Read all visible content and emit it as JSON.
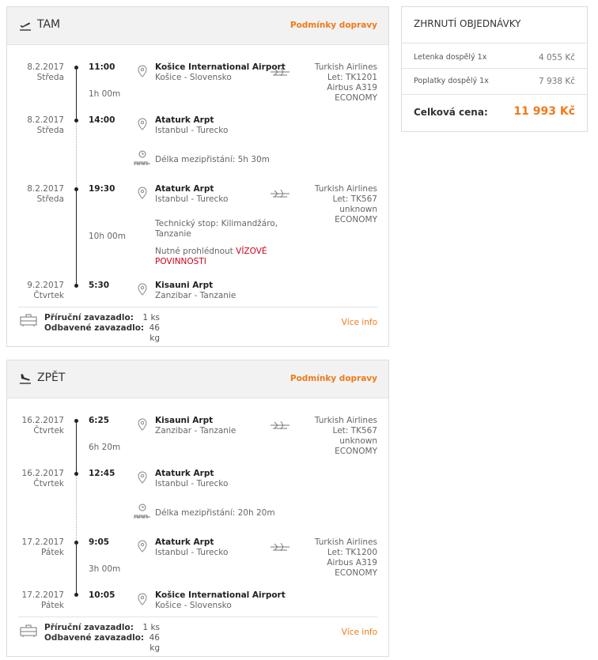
{
  "outbound": {
    "title": "TAM",
    "conditions_link": "Podmínky dopravy",
    "segments": [
      {
        "date": "8.2.2017",
        "day": "Středa",
        "time": "11:00",
        "airport": "Košice International Airport",
        "city": "Košice - Slovensko",
        "airline": "Turkish Airlines",
        "flight": "Let: TK1201",
        "aircraft": "Airbus A319",
        "class": "ECONOMY"
      },
      {
        "date": "8.2.2017",
        "day": "Středa",
        "time": "14:00",
        "airport": "Ataturk Arpt",
        "city": "Istanbul - Turecko"
      },
      {
        "date": "8.2.2017",
        "day": "Středa",
        "time": "19:30",
        "airport": "Ataturk Arpt",
        "city": "Istanbul - Turecko",
        "airline": "Turkish Airlines",
        "flight": "Let: TK567",
        "aircraft": "unknown",
        "class": "ECONOMY"
      },
      {
        "date": "9.2.2017",
        "day": "Čtvrtek",
        "time": "5:30",
        "airport": "Kisauni Arpt",
        "city": "Zanzibar - Tanzanie"
      }
    ],
    "durations": [
      "1h 00m",
      "10h 00m"
    ],
    "layover": "Délka mezipřistání: 5h 30m",
    "tech_stop": "Technický stop: Kilimandžáro, Tanzanie",
    "visa_prefix": "Nutné prohlédnout",
    "visa_link": "VÍZOVÉ POVINNOSTI",
    "baggage": {
      "hand_label": "Příruční zavazadlo:",
      "hand_value": "1 ks",
      "checked_label": "Odbavené zavazadlo:",
      "checked_value": "46 kg"
    },
    "more_info": "Více info"
  },
  "inbound": {
    "title": "ZPĚT",
    "conditions_link": "Podmínky dopravy",
    "segments": [
      {
        "date": "16.2.2017",
        "day": "Čtvrtek",
        "time": "6:25",
        "airport": "Kisauni Arpt",
        "city": "Zanzibar - Tanzanie",
        "airline": "Turkish Airlines",
        "flight": "Let: TK567",
        "aircraft": "unknown",
        "class": "ECONOMY"
      },
      {
        "date": "16.2.2017",
        "day": "Čtvrtek",
        "time": "12:45",
        "airport": "Ataturk Arpt",
        "city": "Istanbul - Turecko"
      },
      {
        "date": "17.2.2017",
        "day": "Pátek",
        "time": "9:05",
        "airport": "Ataturk Arpt",
        "city": "Istanbul - Turecko",
        "airline": "Turkish Airlines",
        "flight": "Let: TK1200",
        "aircraft": "Airbus A319",
        "class": "ECONOMY"
      },
      {
        "date": "17.2.2017",
        "day": "Pátek",
        "time": "10:05",
        "airport": "Košice International Airport",
        "city": "Košice - Slovensko"
      }
    ],
    "durations": [
      "6h 20m",
      "3h 00m"
    ],
    "layover": "Délka mezipřistání: 20h 20m",
    "baggage": {
      "hand_label": "Příruční zavazadlo:",
      "hand_value": "1 ks",
      "checked_label": "Odbavené zavazadlo:",
      "checked_value": "46 kg"
    },
    "more_info": "Více info"
  },
  "summary": {
    "title": "ZHRNUTÍ OBJEDNÁVKY",
    "ticket_label": "Letenka dospělý 1x",
    "ticket_value": "4 055 Kč",
    "fees_label": "Poplatky dospělý 1x",
    "fees_value": "7 938 Kč",
    "total_label": "Celková cena:",
    "total_value": "11 993 Kč",
    "accent_color": "#f07a18"
  }
}
